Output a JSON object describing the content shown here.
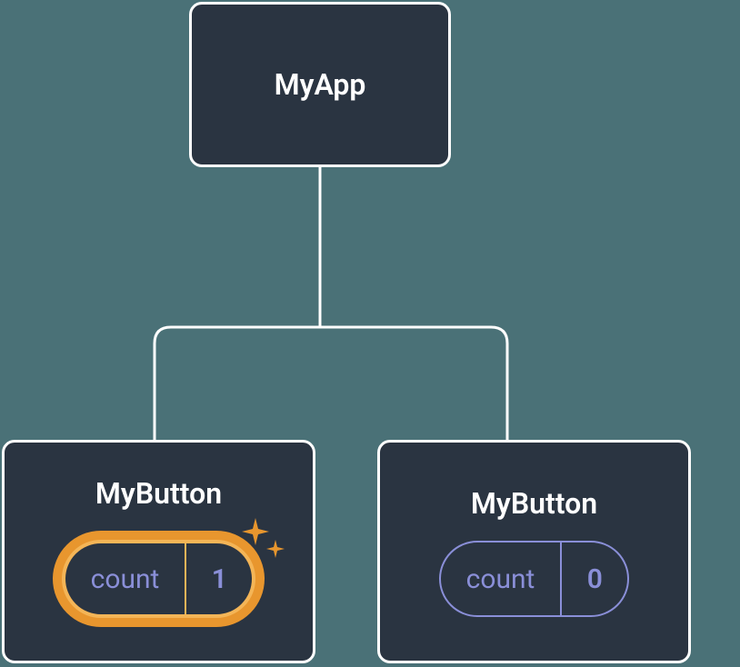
{
  "root": {
    "title": "MyApp"
  },
  "children": [
    {
      "title": "MyButton",
      "state_label": "count",
      "state_value": "1",
      "highlighted": true
    },
    {
      "title": "MyButton",
      "state_label": "count",
      "state_value": "0",
      "highlighted": false
    }
  ]
}
